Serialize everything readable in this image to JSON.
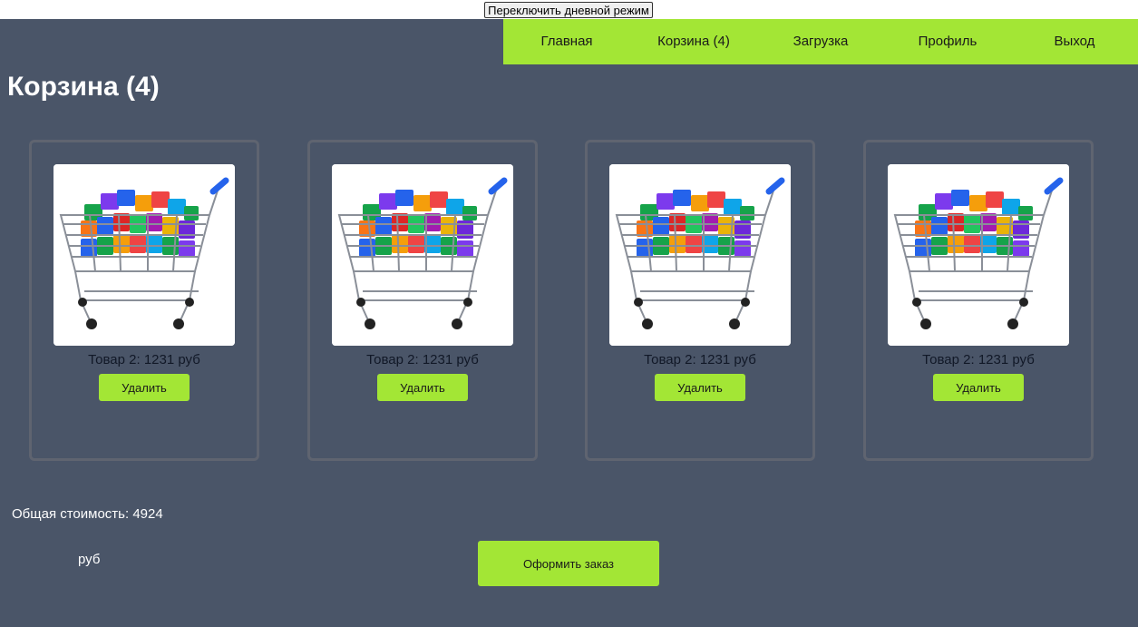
{
  "theme_toggle": {
    "label": "Переключить дневной режим"
  },
  "nav": {
    "items": [
      {
        "label": "Главная"
      },
      {
        "label": "Корзина (4)"
      },
      {
        "label": "Загрузка"
      },
      {
        "label": "Профиль"
      },
      {
        "label": "Выход"
      }
    ]
  },
  "page": {
    "title": "Корзина (4)"
  },
  "cart": {
    "items": [
      {
        "label": "Товар 2: 1231 руб",
        "delete_label": "Удалить",
        "image": "shopping-cart-with-app-icons"
      },
      {
        "label": "Товар 2: 1231 руб",
        "delete_label": "Удалить",
        "image": "shopping-cart-with-app-icons"
      },
      {
        "label": "Товар 2: 1231 руб",
        "delete_label": "Удалить",
        "image": "shopping-cart-with-app-icons"
      },
      {
        "label": "Товар 2: 1231 руб",
        "delete_label": "Удалить",
        "image": "shopping-cart-with-app-icons"
      }
    ],
    "total_label": "Общая стоимость: 4924",
    "total_currency": "руб",
    "checkout_label": "Оформить заказ"
  },
  "colors": {
    "accent": "#a3e635",
    "background": "#4a5568",
    "card_border": "#5f6470"
  }
}
